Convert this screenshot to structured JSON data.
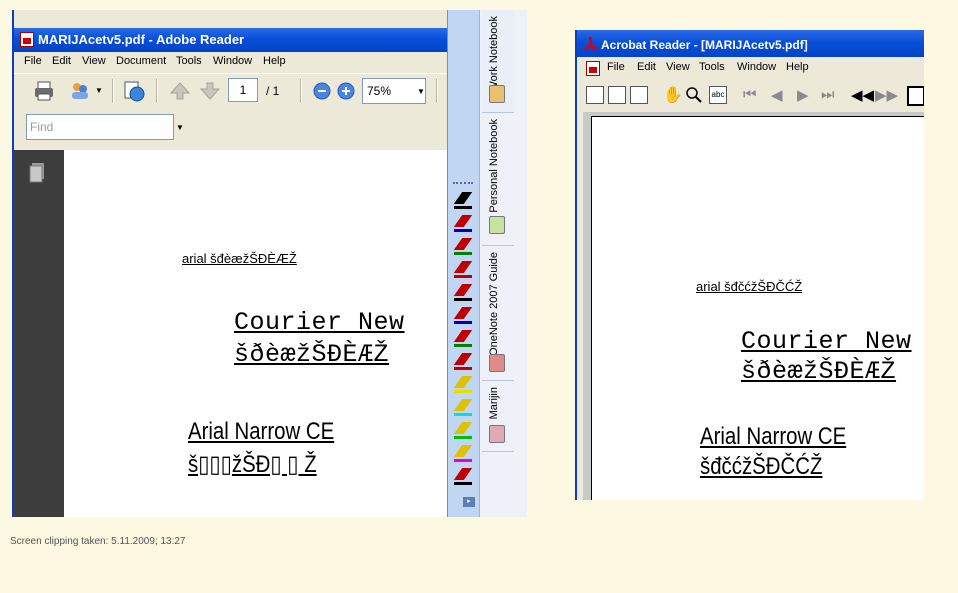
{
  "left_window": {
    "title": "MARIJAcetv5.pdf - Adobe Reader",
    "menu": [
      "File",
      "Edit",
      "View",
      "Document",
      "Tools",
      "Window",
      "Help"
    ],
    "page_number": "1",
    "page_total": "/ 1",
    "zoom": "75%",
    "find_placeholder": "Find",
    "doc": {
      "arial_line": "arial šđèæžŠĐÈÆŽ",
      "courier_line1": "Courier New",
      "courier_line2": "šðèæžŠÐÈÆŽ",
      "narrow_line1": "Arial Narrow CE",
      "narrow_line2": "š▯▯▯žŠĐ▯ ▯ Ž"
    }
  },
  "onenote": {
    "pens": [
      {
        "color": "#000000",
        "line": "#000000"
      },
      {
        "color": "#c00000",
        "line": "#0000c0"
      },
      {
        "color": "#c00000",
        "line": "#008000"
      },
      {
        "color": "#c00000",
        "line": "#c00000"
      },
      {
        "color": "#c00000",
        "line": "#000000"
      },
      {
        "color": "#c00000",
        "line": "#0000c0"
      },
      {
        "color": "#c00000",
        "line": "#008000"
      },
      {
        "color": "#c00000",
        "line": "#c00000"
      },
      {
        "color": "#e0c000",
        "line": "#e0e000"
      },
      {
        "color": "#e0c000",
        "line": "#00e0e0"
      },
      {
        "color": "#e0c000",
        "line": "#00c000"
      },
      {
        "color": "#e0c000",
        "line": "#e000e0"
      },
      {
        "color": "#c00000",
        "line": "#000000"
      }
    ],
    "notebooks": [
      {
        "label": "Work Notebook",
        "color": "#e8c070"
      },
      {
        "label": "Personal Notebook",
        "color": "#c8e0a0"
      },
      {
        "label": "OneNote 2007 Guide",
        "color": "#e08a8a"
      },
      {
        "label": "Marijin",
        "color": "#e0a8b8"
      }
    ]
  },
  "right_window": {
    "title": "Acrobat Reader - [MARIJAcetv5.pdf]",
    "menu": [
      "File",
      "Edit",
      "View",
      "Tools",
      "Window",
      "Help"
    ],
    "doc": {
      "arial_line": "arial šđčćžŠĐČĆŽ",
      "courier_line1": "Courier New",
      "courier_line2": "šðèæžŠÐÈÆŽ",
      "narrow_line1": "Arial Narrow CE",
      "narrow_line2": "šđčćžŠĐČĆŽ"
    }
  },
  "caption": "Screen clipping taken: 5.11.2009; 13:27"
}
